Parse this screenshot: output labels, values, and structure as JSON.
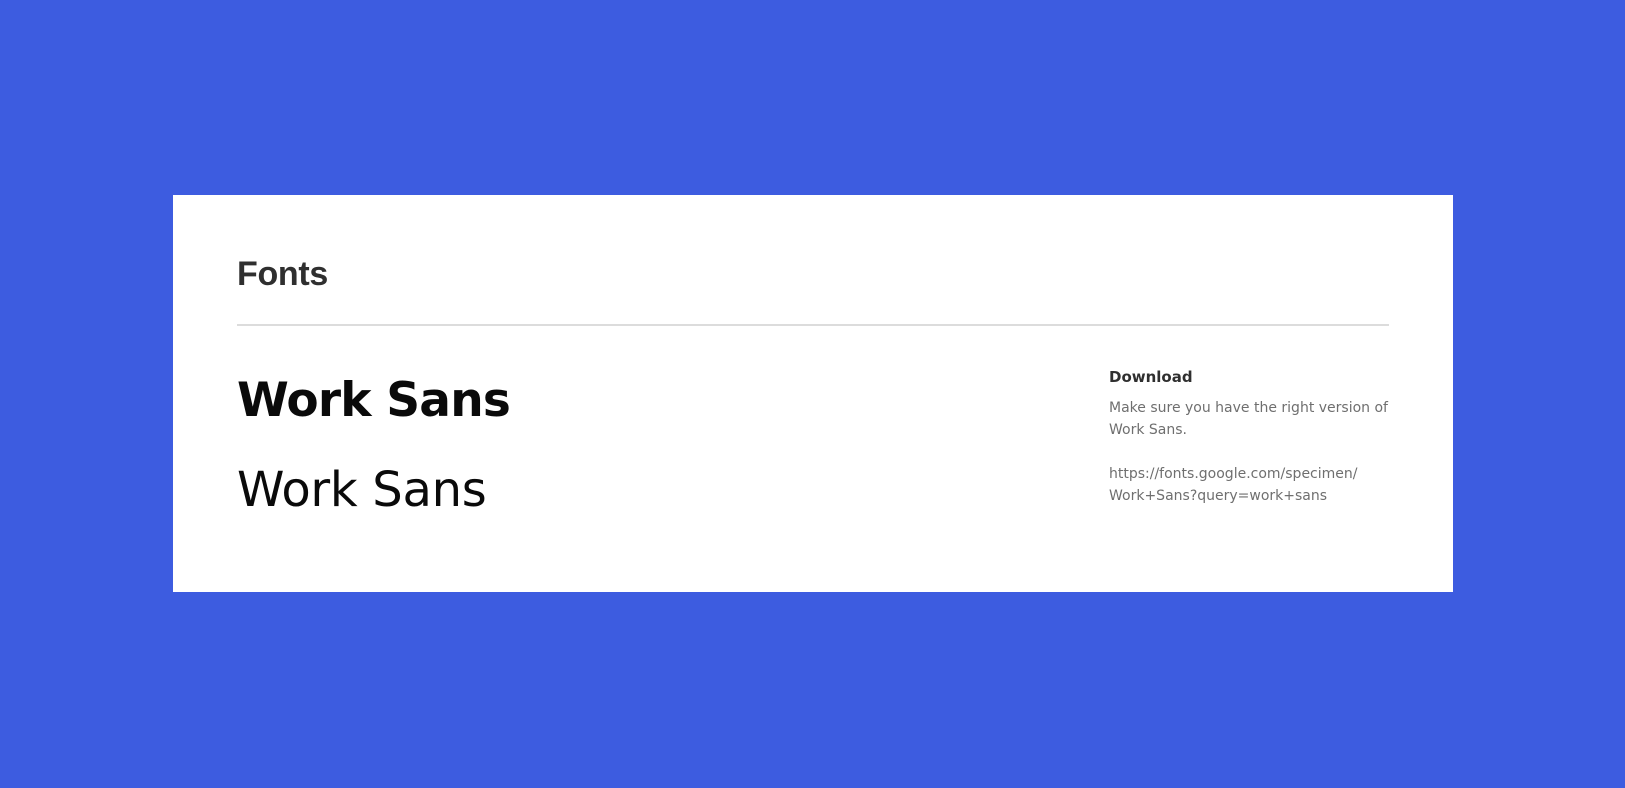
{
  "colors": {
    "background": "#3d5ce0",
    "card": "#ffffff",
    "heading": "#2f2f2f",
    "specimen": "#0a0a0a",
    "muted_text": "#6f6f6f",
    "divider": "#dcdcdc"
  },
  "section": {
    "title": "Fonts"
  },
  "specimens": {
    "bold": "Work Sans",
    "regular": "Work Sans"
  },
  "download": {
    "title": "Download",
    "description": "Make sure you have the right version of Work Sans.",
    "link_line1": "https://fonts.google.com/specimen/",
    "link_line2": "Work+Sans?query=work+sans"
  }
}
